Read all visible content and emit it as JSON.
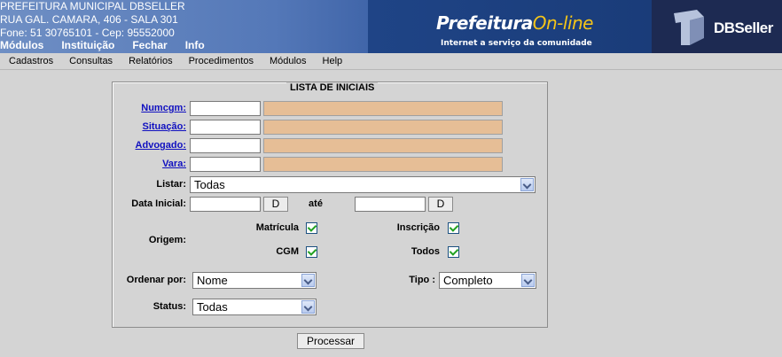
{
  "header": {
    "lines": [
      "PREFEITURA MUNICIPAL DBSELLER",
      "RUA GAL. CAMARA, 406 - SALA 301",
      "Fone: 51 30765101  -  Cep: 95552000"
    ],
    "menu": [
      "Módulos",
      "Instituição",
      "Fechar",
      "Info"
    ],
    "brand_main": "Prefeitura",
    "brand_online": "On-line",
    "brand_sub": "Internet a serviço da comunidade",
    "dbseller": "DBSeller"
  },
  "menubar": [
    "Cadastros",
    "Consultas",
    "Relatórios",
    "Procedimentos",
    "Módulos",
    "Help"
  ],
  "form": {
    "legend": "LISTA DE INICIAIS",
    "numcgm_label": "Numcgm:",
    "situacao_label": "Situação:",
    "advogado_label": "Advogado:",
    "vara_label": "Vara:",
    "listar_label": "Listar:",
    "listar_value": "Todas",
    "data_inicial_label": "Data Inicial:",
    "d_button": "D",
    "ate_label": "até",
    "origem_label": "Origem:",
    "matricula_label": "Matrícula",
    "inscricao_label": "Inscrição",
    "cgm_label": "CGM",
    "todos_label": "Todos",
    "ordenar_label": "Ordenar por:",
    "ordenar_value": "Nome",
    "tipo_label": "Tipo :",
    "tipo_value": "Completo",
    "status_label": "Status:",
    "status_value": "Todas",
    "processar": "Processar"
  }
}
